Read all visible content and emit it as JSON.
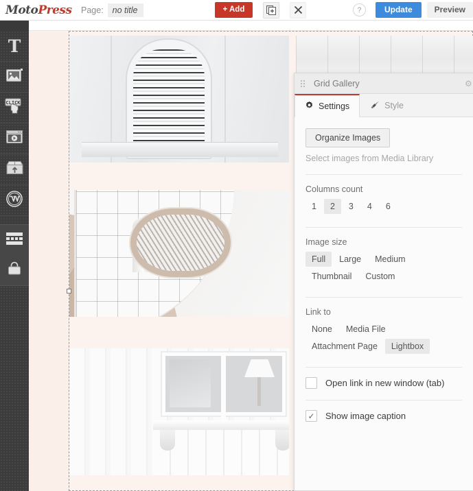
{
  "topbar": {
    "logo_moto": "Moto",
    "logo_press": "Press",
    "page_label": "Page:",
    "page_title_value": "no title",
    "page_title_placeholder": "no title",
    "add_label": "+ Add",
    "duplicate_icon": "duplicate-page-icon",
    "close_icon": "close-icon",
    "help_label": "?",
    "update_label": "Update",
    "preview_label": "Preview",
    "accent_red": "#c63727",
    "accent_blue": "#3c8bdc"
  },
  "sidebar": {
    "items": [
      {
        "name": "text",
        "icon": "text-icon",
        "glyph": "T"
      },
      {
        "name": "image",
        "icon": "image-icon",
        "glyph": ""
      },
      {
        "name": "button",
        "icon": "click-button-icon",
        "glyph": "CLICK"
      },
      {
        "name": "media",
        "icon": "video-player-icon",
        "glyph": ""
      },
      {
        "name": "package",
        "icon": "package-upload-icon",
        "glyph": ""
      },
      {
        "name": "wordpress",
        "icon": "wordpress-icon",
        "glyph": ""
      },
      {
        "name": "rows",
        "icon": "layout-rows-icon",
        "glyph": ""
      },
      {
        "name": "shop",
        "icon": "shopping-bag-icon",
        "glyph": ""
      }
    ]
  },
  "canvas": {
    "images": [
      {
        "alt": "white arched louvered vent on wall"
      },
      {
        "alt": "curved white and beige tiled architecture"
      },
      {
        "alt": "white wooden house window with lamp inside"
      },
      {
        "alt": "white minimal interior with staircase"
      }
    ]
  },
  "panel": {
    "title": "Grid Gallery",
    "drag_handle_icon": "drag-dots-icon",
    "tabs": [
      {
        "label": "Settings",
        "icon": "gear-icon",
        "active": true
      },
      {
        "label": "Style",
        "icon": "brush-icon",
        "active": false
      }
    ],
    "active_tab_border_color": "#c0392b",
    "organize_button": "Organize Images",
    "organize_hint": "Select images from Media Library",
    "columns": {
      "label": "Columns count",
      "options": [
        "1",
        "2",
        "3",
        "4",
        "6"
      ],
      "selected": "2"
    },
    "image_size": {
      "label": "Image size",
      "options": [
        "Full",
        "Large",
        "Medium",
        "Thumbnail",
        "Custom"
      ],
      "selected": "Full"
    },
    "link_to": {
      "label": "Link to",
      "options": [
        "None",
        "Media File",
        "Attachment Page",
        "Lightbox"
      ],
      "selected": "Lightbox"
    },
    "checkboxes": [
      {
        "label": "Open link in new window (tab)",
        "checked": false,
        "mark": ""
      },
      {
        "label": "Show image caption",
        "checked": true,
        "mark": "✓"
      }
    ]
  }
}
